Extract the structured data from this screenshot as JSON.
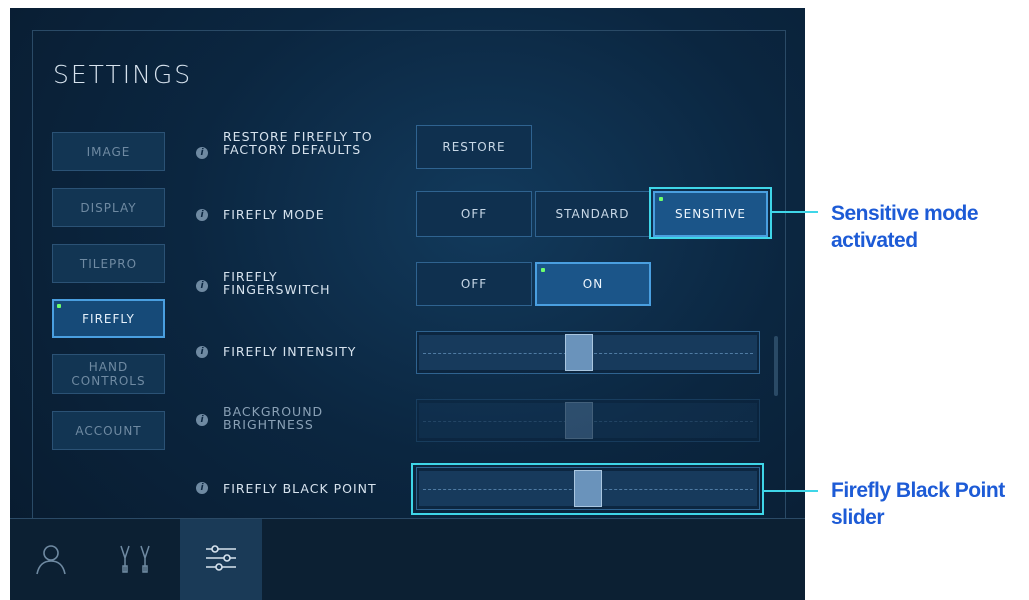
{
  "title": "SETTINGS",
  "nav": [
    {
      "label": "IMAGE",
      "active": false
    },
    {
      "label": "DISPLAY",
      "active": false
    },
    {
      "label": "TILEPRO",
      "active": false
    },
    {
      "label": "FIREFLY",
      "active": true
    },
    {
      "label": "HAND\nCONTROLS",
      "active": false
    },
    {
      "label": "ACCOUNT",
      "active": false
    }
  ],
  "settings": {
    "restore": {
      "label": "RESTORE FIREFLY TO\nFACTORY DEFAULTS",
      "button": "RESTORE"
    },
    "mode": {
      "label": "FIREFLY MODE",
      "options": [
        "OFF",
        "STANDARD",
        "SENSITIVE"
      ],
      "selected": "SENSITIVE"
    },
    "fingerswitch": {
      "label": "FIREFLY\nFINGERSWITCH",
      "options": [
        "OFF",
        "ON"
      ],
      "selected": "ON"
    },
    "intensity": {
      "label": "FIREFLY INTENSITY",
      "value": 0.47
    },
    "background": {
      "label": "BACKGROUND\nBRIGHTNESS",
      "value": 0.47,
      "disabled": true
    },
    "blackpoint": {
      "label": "FIREFLY BLACK POINT",
      "value": 0.5
    }
  },
  "info_glyph": "i",
  "bottom_tabs": [
    {
      "icon": "user-icon",
      "active": false
    },
    {
      "icon": "instruments-icon",
      "active": false
    },
    {
      "icon": "settings-sliders-icon",
      "active": true
    }
  ],
  "annotations": {
    "sensitive": "Sensitive mode\nactivated",
    "blackpoint": "Firefly Black Point\nslider"
  },
  "colors": {
    "accent": "#4a9fe0",
    "highlight": "#3fd6e8",
    "annotation_text": "#1d5bd6",
    "led": "#6dff6d"
  }
}
